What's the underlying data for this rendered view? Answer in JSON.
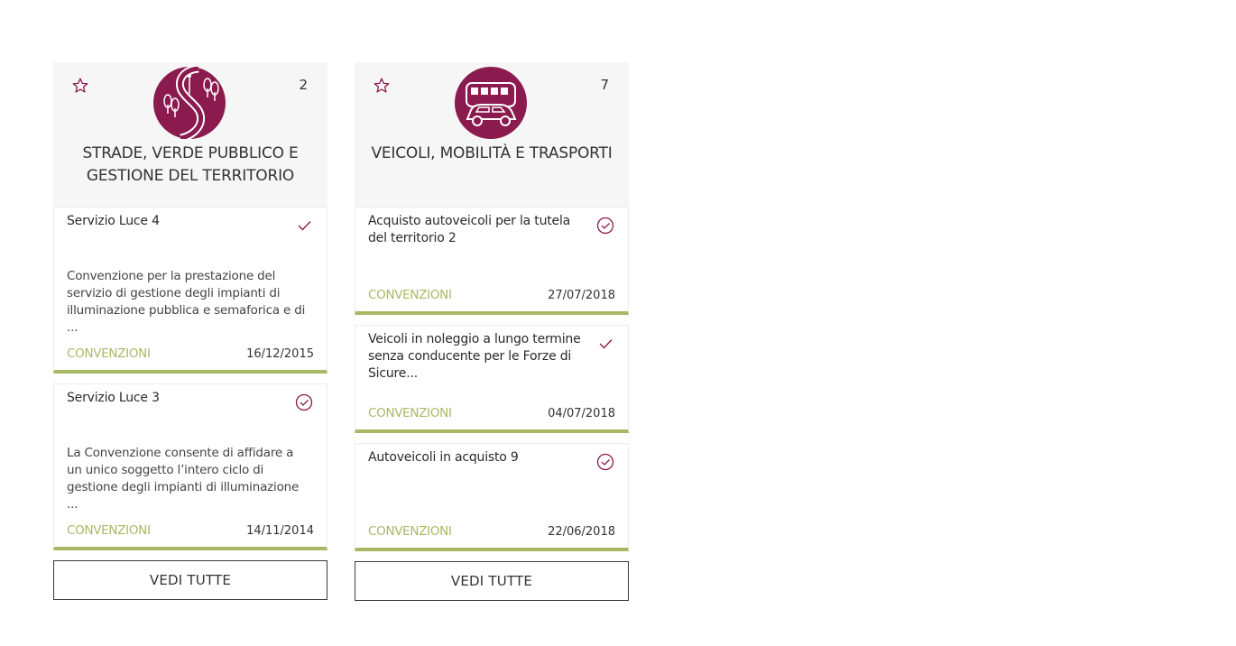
{
  "colors": {
    "accent": "#8b1a4e",
    "green": "#a9b863",
    "header_bg": "#f6f6f6"
  },
  "columns": [
    {
      "icon": "road-trees-icon",
      "count": "2",
      "title_line1": "STRADE, VERDE PUBBLICO E",
      "title_line2": "GESTIONE DEL TERRITORIO",
      "cards": [
        {
          "title": "Servizio Luce 4",
          "status": "check-icon",
          "desc": "Convenzione per la prestazione del servizio di gestione degli impianti di illuminazione pubblica e semaforica e di ...",
          "category": "CONVENZIONI",
          "date": "16/12/2015"
        },
        {
          "title": "Servizio Luce 3",
          "status": "check-circle-icon",
          "desc": "La Convenzione consente di affidare a un unico soggetto l’intero ciclo di gestione degli impianti di illuminazione ...",
          "category": "CONVENZIONI",
          "date": "14/11/2014"
        }
      ],
      "button": "VEDI TUTTE"
    },
    {
      "icon": "bus-car-icon",
      "count": "7",
      "title_line1": "VEICOLI, MOBILITÀ E TRASPORTI",
      "cards": [
        {
          "title": "Acquisto autoveicoli per la tutela del territorio 2",
          "status": "check-circle-icon",
          "category": "CONVENZIONI",
          "date": "27/07/2018"
        },
        {
          "title": "Veicoli in noleggio a lungo termine senza conducente per le Forze di Sicure...",
          "status": "check-icon",
          "category": "CONVENZIONI",
          "date": "04/07/2018"
        },
        {
          "title": "Autoveicoli in acquisto 9",
          "status": "check-circle-icon",
          "category": "CONVENZIONI",
          "date": "22/06/2018"
        }
      ],
      "button": "VEDI TUTTE"
    }
  ]
}
